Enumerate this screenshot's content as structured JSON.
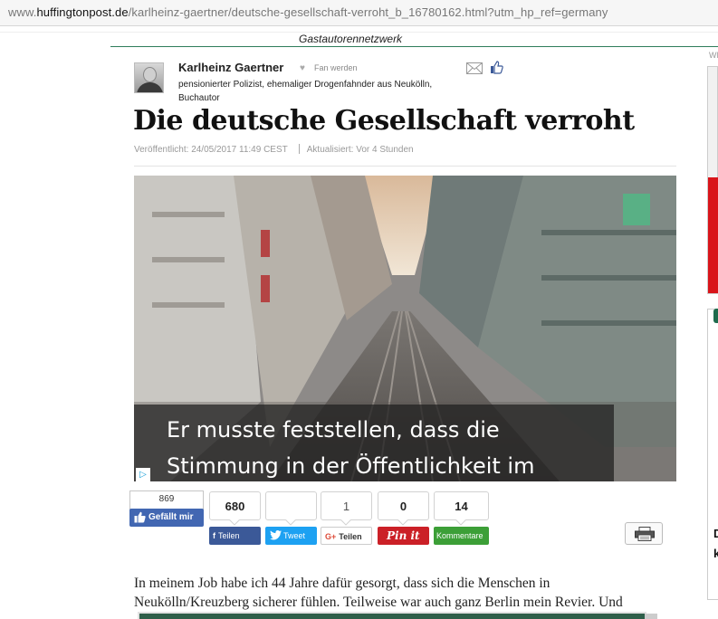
{
  "browser": {
    "url_prefix": "www.",
    "url_domain": "huffingtonpost.de",
    "url_path": "/karlheinz-gaertner/deutsche-gesellschaft-verroht_b_16780162.html?utm_hp_ref=germany"
  },
  "header": {
    "network_label": "Gastautorennetzwerk"
  },
  "sidebar": {
    "label": "WE",
    "teaser_line1": "D",
    "teaser_line2": "k"
  },
  "author": {
    "name": "Karlheinz Gaertner",
    "fan_label": "Fan werden",
    "bio": "pensionierter Polizist, ehemaliger Drogenfahnder aus Neukölln, Buchautor"
  },
  "article": {
    "headline": "Die deutsche Gesellschaft verroht",
    "published": "Veröffentlicht: 24/05/2017 11:49 CEST",
    "updated": "Aktualisiert: Vor 4 Stunden",
    "body_line1": "In meinem Job habe ich 44 Jahre dafür gesorgt, dass sich die Menschen in",
    "body_line2": "Neukölln/Kreuzberg sicherer fühlen. Teilweise war auch ganz Berlin mein Revier. Und"
  },
  "video": {
    "caption_line1": "Er musste feststellen, dass die",
    "caption_line2": "Stimmung in der Öffentlichkeit im",
    "ad_badge": "▷"
  },
  "share": {
    "fb_like_count": "869",
    "fb_like_label": "Gefällt mir",
    "facebook_count": "680",
    "twitter_count": "",
    "google_count": "1",
    "pinterest_count": "0",
    "comments_count": "14",
    "facebook_label": "Teilen",
    "twitter_label": "Tweet",
    "google_label": "Teilen",
    "pinterest_label": "Pin it",
    "comments_label": "Kommentare"
  },
  "colors": {
    "accent_green": "#2e7d5b",
    "facebook": "#3b5998",
    "twitter": "#1da1f2",
    "pinterest": "#cb2027",
    "comments": "#3c9f37"
  }
}
